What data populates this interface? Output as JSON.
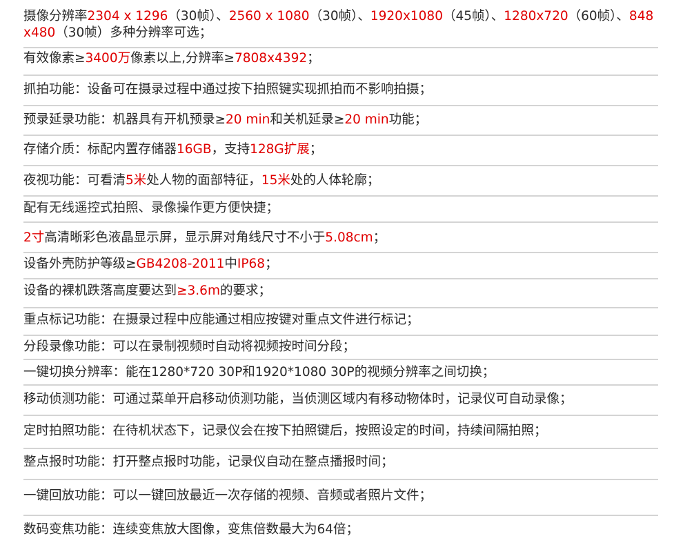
{
  "colors": {
    "text": "#2b2b2b",
    "highlight": "#e00000",
    "divider": "#d4d4d4",
    "background": "#ffffff"
  },
  "specs": [
    {
      "name": "spec-resolutions",
      "segments": [
        {
          "text": "摄像分辨率",
          "hl": false
        },
        {
          "text": "2304 x 1296",
          "hl": true
        },
        {
          "text": "（30帧）、",
          "hl": false
        },
        {
          "text": "2560 x 1080",
          "hl": true
        },
        {
          "text": "（30帧）、",
          "hl": false
        },
        {
          "text": "1920x1080",
          "hl": true
        },
        {
          "text": "（45帧）、",
          "hl": false
        },
        {
          "text": "1280x720",
          "hl": true
        },
        {
          "text": "（60帧）、",
          "hl": false
        },
        {
          "text": "848 x480",
          "hl": true
        },
        {
          "text": "（30帧）多种分辨率可选；",
          "hl": false
        }
      ]
    },
    {
      "name": "spec-effective-pixels",
      "segments": [
        {
          "text": "有效像素≥",
          "hl": false
        },
        {
          "text": "3400万",
          "hl": true
        },
        {
          "text": "像素以上,分辨率≥",
          "hl": false
        },
        {
          "text": "7808x4392",
          "hl": true
        },
        {
          "text": "；",
          "hl": false
        }
      ]
    },
    {
      "name": "spec-snapshot",
      "segments": [
        {
          "text": "抓拍功能：设备可在摄录过程中通过按下拍照键实现抓拍而不影响拍摄；",
          "hl": false
        }
      ]
    },
    {
      "name": "spec-pre-post-record",
      "segments": [
        {
          "text": "预录延录功能：机器具有开机预录≥",
          "hl": false
        },
        {
          "text": "20 min",
          "hl": true
        },
        {
          "text": "和关机延录≥",
          "hl": false
        },
        {
          "text": "20 min",
          "hl": true
        },
        {
          "text": "功能；",
          "hl": false
        }
      ]
    },
    {
      "name": "spec-storage",
      "segments": [
        {
          "text": "存储介质：标配内置存储器",
          "hl": false
        },
        {
          "text": "16GB",
          "hl": true
        },
        {
          "text": "，支持",
          "hl": false
        },
        {
          "text": "128G扩展",
          "hl": true
        },
        {
          "text": "；",
          "hl": false
        }
      ]
    },
    {
      "name": "spec-night-vision",
      "segments": [
        {
          "text": "夜视功能：可看清",
          "hl": false
        },
        {
          "text": "5米",
          "hl": true
        },
        {
          "text": "处人物的面部特征，",
          "hl": false
        },
        {
          "text": "15米",
          "hl": true
        },
        {
          "text": "处的人体轮廓；",
          "hl": false
        }
      ]
    },
    {
      "name": "spec-wireless-remote",
      "segments": [
        {
          "text": "配有无线遥控式拍照、录像操作更方便快捷；",
          "hl": false
        }
      ]
    },
    {
      "name": "spec-screen",
      "segments": [
        {
          "text": "2寸",
          "hl": true
        },
        {
          "text": "高清晰彩色液晶显示屏，显示屏对角线尺寸不小于",
          "hl": false
        },
        {
          "text": "5.08cm",
          "hl": true
        },
        {
          "text": "；",
          "hl": false
        }
      ]
    },
    {
      "name": "spec-protection",
      "segments": [
        {
          "text": "设备外壳防护等级≥",
          "hl": false
        },
        {
          "text": "GB4208-2011",
          "hl": true
        },
        {
          "text": "中",
          "hl": false
        },
        {
          "text": "IP68",
          "hl": true
        },
        {
          "text": "；",
          "hl": false
        }
      ]
    },
    {
      "name": "spec-drop-height",
      "segments": [
        {
          "text": "设备的裸机跌落高度要达到",
          "hl": false
        },
        {
          "text": "≥3.6m",
          "hl": true
        },
        {
          "text": "的要求；",
          "hl": false
        }
      ]
    },
    {
      "name": "spec-key-file-marking",
      "segments": [
        {
          "text": "重点标记功能：在摄录过程中应能通过相应按键对重点文件进行标记；",
          "hl": false
        }
      ]
    },
    {
      "name": "spec-segmented-recording",
      "segments": [
        {
          "text": "分段录像功能：可以在录制视频时自动将视频按时间分段；",
          "hl": false
        }
      ]
    },
    {
      "name": "spec-one-key-resolution",
      "segments": [
        {
          "text": "一键切换分辨率：能在1280*720 30P和1920*1080 30P的视频分辨率之间切换；",
          "hl": false
        }
      ]
    },
    {
      "name": "spec-motion-detection",
      "segments": [
        {
          "text": "移动侦测功能：可通过菜单开启移动侦测功能，当侦测区域内有移动物体时，记录仪可自动录像；",
          "hl": false
        }
      ]
    },
    {
      "name": "spec-timed-photo",
      "segments": [
        {
          "text": "定时拍照功能：在待机状态下，记录仪会在按下拍照键后，按照设定的时间，持续间隔拍照；",
          "hl": false
        }
      ]
    },
    {
      "name": "spec-hourly-chime",
      "segments": [
        {
          "text": "整点报时功能：打开整点报时功能，记录仪自动在整点播报时间；",
          "hl": false
        }
      ]
    },
    {
      "name": "spec-one-key-playback",
      "segments": [
        {
          "text": "一键回放功能：可以一键回放最近一次存储的视频、音频或者照片文件；",
          "hl": false
        }
      ]
    },
    {
      "name": "spec-digital-zoom",
      "segments": [
        {
          "text": "数码变焦功能：连续变焦放大图像，变焦倍数最大为64倍；",
          "hl": false
        }
      ]
    }
  ]
}
